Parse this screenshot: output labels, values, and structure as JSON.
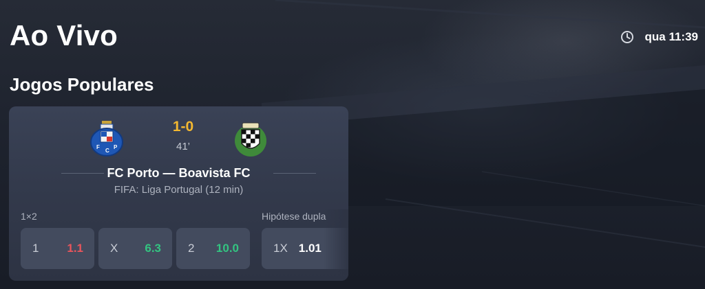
{
  "header": {
    "title": "Ao Vivo",
    "clock_icon": "clock-icon",
    "time": "qua 11:39"
  },
  "section": {
    "title": "Jogos Populares"
  },
  "match": {
    "home_logo": "fc-porto-crest",
    "away_logo": "boavista-fc-crest",
    "score": "1-0",
    "minute": "41’",
    "name": "FC Porto — Boavista FC",
    "league": "FIFA: Liga Portugal (12 min)",
    "markets": {
      "main_label": "1×2",
      "double_label": "Hipótese dupla",
      "odds": [
        {
          "selection": "1",
          "value": "1.1",
          "color": "#e9555c"
        },
        {
          "selection": "X",
          "value": "6.3",
          "color": "#33c481"
        },
        {
          "selection": "2",
          "value": "10.0",
          "color": "#33c481"
        },
        {
          "selection": "1X",
          "value": "1.01",
          "color": "#ffffff"
        }
      ]
    }
  }
}
